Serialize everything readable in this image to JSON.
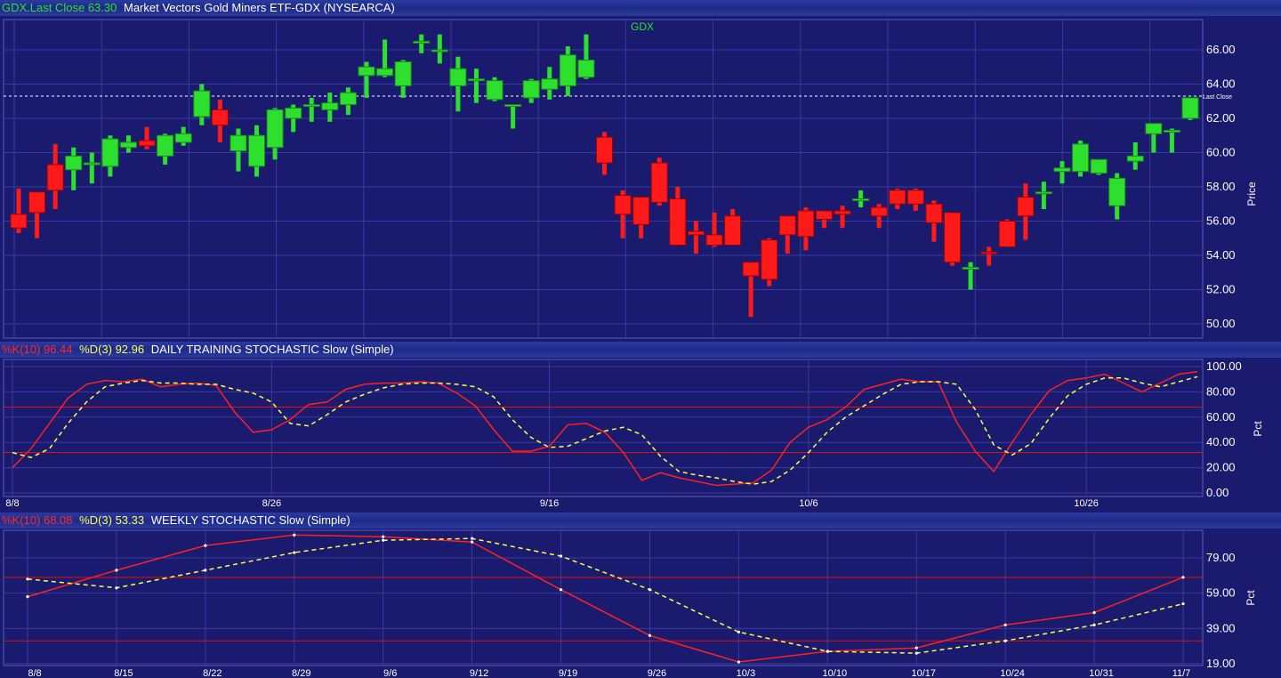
{
  "price_pane": {
    "header_symbol": "GDX.Last Close 63.30",
    "header_name": "Market Vectors Gold Miners ETF-GDX (NYSEARCA)",
    "label": "GDX",
    "axis_title": "Price",
    "last_close_label": "Last Close"
  },
  "daily_pane": {
    "k_label": "%K(10) 96.44",
    "d_label": "%D(3) 92.96",
    "title": "DAILY TRAINING STOCHASTIC Slow (Simple)",
    "axis_title": "Pct"
  },
  "weekly_pane": {
    "k_label": "%K(10) 68.08",
    "d_label": "%D(3) 53.33",
    "title": "WEEKLY STOCHASTIC Slow (Simple)",
    "axis_title": "Pct"
  },
  "colors": {
    "background": "#1a1a6e",
    "up_candle": "#2ee02e",
    "down_candle": "#ff1a1a",
    "k_line": "#ff2020",
    "d_line": "#ffff44",
    "grid": "#3a3aa0"
  },
  "chart_data": [
    {
      "type": "candlestick",
      "title": "GDX",
      "ylabel": "Price",
      "ylim": [
        50,
        67
      ],
      "yticks": [
        "50.00",
        "52.00",
        "54.00",
        "56.00",
        "58.00",
        "60.00",
        "62.00",
        "64.00",
        "66.00"
      ],
      "last_close": 63.3,
      "candles": [
        {
          "o": 56.4,
          "h": 57.9,
          "l": 55.3,
          "c": 55.6
        },
        {
          "o": 57.7,
          "h": 57.7,
          "l": 55.0,
          "c": 56.5
        },
        {
          "o": 59.3,
          "h": 60.5,
          "l": 56.7,
          "c": 57.8
        },
        {
          "o": 59.0,
          "h": 60.3,
          "l": 57.8,
          "c": 59.8
        },
        {
          "o": 59.4,
          "h": 60.0,
          "l": 58.2,
          "c": 59.4
        },
        {
          "o": 59.2,
          "h": 61.0,
          "l": 58.6,
          "c": 60.8
        },
        {
          "o": 60.3,
          "h": 61.0,
          "l": 60.0,
          "c": 60.6
        },
        {
          "o": 60.7,
          "h": 61.5,
          "l": 60.2,
          "c": 60.4
        },
        {
          "o": 59.8,
          "h": 61.1,
          "l": 59.3,
          "c": 61.0
        },
        {
          "o": 60.6,
          "h": 61.5,
          "l": 60.4,
          "c": 61.1
        },
        {
          "o": 62.1,
          "h": 64.0,
          "l": 61.6,
          "c": 63.6
        },
        {
          "o": 62.5,
          "h": 63.1,
          "l": 60.6,
          "c": 61.6
        },
        {
          "o": 60.1,
          "h": 61.4,
          "l": 58.9,
          "c": 61.0
        },
        {
          "o": 59.2,
          "h": 61.6,
          "l": 58.6,
          "c": 61.0
        },
        {
          "o": 60.3,
          "h": 62.6,
          "l": 59.6,
          "c": 62.5
        },
        {
          "o": 62.0,
          "h": 62.8,
          "l": 61.2,
          "c": 62.6
        },
        {
          "o": 62.8,
          "h": 63.2,
          "l": 61.8,
          "c": 62.8
        },
        {
          "o": 62.5,
          "h": 63.5,
          "l": 61.8,
          "c": 62.9
        },
        {
          "o": 62.8,
          "h": 63.8,
          "l": 62.2,
          "c": 63.5
        },
        {
          "o": 64.5,
          "h": 65.3,
          "l": 63.2,
          "c": 65.0
        },
        {
          "o": 64.5,
          "h": 66.6,
          "l": 64.4,
          "c": 64.9
        },
        {
          "o": 63.9,
          "h": 65.4,
          "l": 63.2,
          "c": 65.3
        },
        {
          "o": 66.5,
          "h": 66.9,
          "l": 65.8,
          "c": 66.5
        },
        {
          "o": 66.0,
          "h": 66.9,
          "l": 65.2,
          "c": 66.0
        },
        {
          "o": 63.9,
          "h": 65.6,
          "l": 62.4,
          "c": 64.9
        },
        {
          "o": 64.3,
          "h": 64.9,
          "l": 62.9,
          "c": 64.3
        },
        {
          "o": 63.1,
          "h": 64.4,
          "l": 63.0,
          "c": 64.2
        },
        {
          "o": 62.8,
          "h": 62.8,
          "l": 61.4,
          "c": 62.8
        },
        {
          "o": 63.2,
          "h": 64.3,
          "l": 62.9,
          "c": 64.2
        },
        {
          "o": 63.7,
          "h": 65.0,
          "l": 63.1,
          "c": 64.3
        },
        {
          "o": 63.9,
          "h": 66.2,
          "l": 63.3,
          "c": 65.7
        },
        {
          "o": 64.4,
          "h": 66.9,
          "l": 64.3,
          "c": 65.4
        },
        {
          "o": 60.9,
          "h": 61.2,
          "l": 58.7,
          "c": 59.4
        },
        {
          "o": 57.5,
          "h": 57.8,
          "l": 55.0,
          "c": 56.4
        },
        {
          "o": 57.4,
          "h": 57.4,
          "l": 55.0,
          "c": 55.8
        },
        {
          "o": 59.4,
          "h": 59.7,
          "l": 56.9,
          "c": 57.1
        },
        {
          "o": 57.3,
          "h": 58.0,
          "l": 54.6,
          "c": 54.6
        },
        {
          "o": 55.4,
          "h": 56.0,
          "l": 54.1,
          "c": 55.2
        },
        {
          "o": 55.2,
          "h": 56.5,
          "l": 54.5,
          "c": 54.6
        },
        {
          "o": 56.3,
          "h": 56.7,
          "l": 54.6,
          "c": 54.6
        },
        {
          "o": 53.6,
          "h": 53.6,
          "l": 50.4,
          "c": 52.8
        },
        {
          "o": 54.9,
          "h": 55.0,
          "l": 52.2,
          "c": 52.6
        },
        {
          "o": 56.3,
          "h": 56.3,
          "l": 54.1,
          "c": 55.2
        },
        {
          "o": 56.6,
          "h": 56.8,
          "l": 54.3,
          "c": 55.1
        },
        {
          "o": 56.6,
          "h": 56.6,
          "l": 55.6,
          "c": 56.1
        },
        {
          "o": 56.6,
          "h": 56.9,
          "l": 55.6,
          "c": 56.4
        },
        {
          "o": 57.3,
          "h": 57.8,
          "l": 56.8,
          "c": 57.3
        },
        {
          "o": 56.8,
          "h": 57.0,
          "l": 55.6,
          "c": 56.3
        },
        {
          "o": 57.8,
          "h": 57.9,
          "l": 56.7,
          "c": 57.0
        },
        {
          "o": 57.8,
          "h": 57.9,
          "l": 56.6,
          "c": 57.0
        },
        {
          "o": 57.0,
          "h": 57.2,
          "l": 54.8,
          "c": 55.9
        },
        {
          "o": 56.5,
          "h": 56.5,
          "l": 53.4,
          "c": 53.6
        },
        {
          "o": 53.3,
          "h": 53.6,
          "l": 52.0,
          "c": 53.3
        },
        {
          "o": 54.2,
          "h": 54.5,
          "l": 53.4,
          "c": 54.1
        },
        {
          "o": 56.0,
          "h": 56.1,
          "l": 54.5,
          "c": 54.5
        },
        {
          "o": 57.4,
          "h": 58.2,
          "l": 54.9,
          "c": 56.3
        },
        {
          "o": 57.7,
          "h": 58.3,
          "l": 56.7,
          "c": 57.7
        },
        {
          "o": 58.9,
          "h": 59.5,
          "l": 58.2,
          "c": 59.1
        },
        {
          "o": 58.9,
          "h": 60.7,
          "l": 58.6,
          "c": 60.5
        },
        {
          "o": 58.8,
          "h": 59.6,
          "l": 58.7,
          "c": 59.6
        },
        {
          "o": 56.9,
          "h": 58.8,
          "l": 56.1,
          "c": 58.5
        },
        {
          "o": 59.5,
          "h": 60.6,
          "l": 59.0,
          "c": 59.8
        },
        {
          "o": 61.1,
          "h": 61.7,
          "l": 60.0,
          "c": 61.7
        },
        {
          "o": 61.3,
          "h": 61.4,
          "l": 60.0,
          "c": 61.3
        },
        {
          "o": 62.0,
          "h": 63.2,
          "l": 61.9,
          "c": 63.2
        }
      ]
    },
    {
      "type": "line",
      "title": "DAILY TRAINING STOCHASTIC Slow (Simple)",
      "ylabel": "Pct",
      "ylim": [
        0,
        100
      ],
      "yticks": [
        "0.00",
        "20.00",
        "40.00",
        "60.00",
        "80.00",
        "100.00"
      ],
      "reference_lines": [
        32,
        68
      ],
      "x_tick_labels": [
        {
          "label": "8/8",
          "index": 0
        },
        {
          "label": "8/26",
          "index": 14
        },
        {
          "label": "9/16",
          "index": 29
        },
        {
          "label": "10/6",
          "index": 43
        },
        {
          "label": "10/26",
          "index": 58
        }
      ],
      "series": [
        {
          "name": "%K(10)",
          "values": [
            20,
            35,
            55,
            75,
            86,
            89,
            88,
            90,
            84,
            86,
            87,
            85,
            64,
            48,
            50,
            58,
            70,
            72,
            82,
            86,
            87,
            87,
            88,
            87,
            79,
            69,
            50,
            33,
            33,
            37,
            54,
            55,
            48,
            32,
            10,
            16,
            12,
            9,
            6,
            7,
            8,
            18,
            40,
            52,
            58,
            68,
            82,
            86,
            90,
            88,
            88,
            56,
            33,
            17,
            40,
            62,
            81,
            89,
            91,
            94,
            87,
            80,
            87,
            94,
            96
          ],
          "style": "solid"
        },
        {
          "name": "%D(3)",
          "values": [
            32,
            28,
            35,
            55,
            72,
            84,
            87,
            89,
            87,
            87,
            86,
            86,
            82,
            79,
            72,
            55,
            53,
            62,
            72,
            78,
            83,
            86,
            87,
            87,
            86,
            84,
            76,
            58,
            44,
            36,
            37,
            43,
            49,
            52,
            46,
            29,
            17,
            14,
            12,
            9,
            7,
            9,
            18,
            32,
            48,
            60,
            69,
            78,
            86,
            88,
            88,
            86,
            66,
            38,
            30,
            39,
            59,
            77,
            86,
            91,
            91,
            87,
            84,
            88,
            92
          ],
          "style": "dashed"
        }
      ]
    },
    {
      "type": "line",
      "title": "WEEKLY STOCHASTIC Slow (Simple)",
      "ylabel": "Pct",
      "yticks": [
        "19.00",
        "39.00",
        "59.00",
        "79.00"
      ],
      "ylim": [
        18,
        93
      ],
      "reference_lines": [
        32,
        68
      ],
      "categories": [
        "8/8",
        "8/15",
        "8/22",
        "8/29",
        "9/6",
        "9/12",
        "9/19",
        "9/26",
        "10/3",
        "10/10",
        "10/17",
        "10/24",
        "10/31",
        "11/7"
      ],
      "series": [
        {
          "name": "%K(10)",
          "values": [
            57,
            72,
            86,
            92,
            91,
            88,
            61,
            35,
            20,
            26,
            28,
            41,
            48,
            68
          ],
          "style": "solid"
        },
        {
          "name": "%D(3)",
          "values": [
            67,
            62,
            72,
            82,
            89,
            90,
            80,
            61,
            37,
            26,
            25,
            32,
            41,
            53
          ],
          "style": "dashed"
        }
      ]
    }
  ]
}
